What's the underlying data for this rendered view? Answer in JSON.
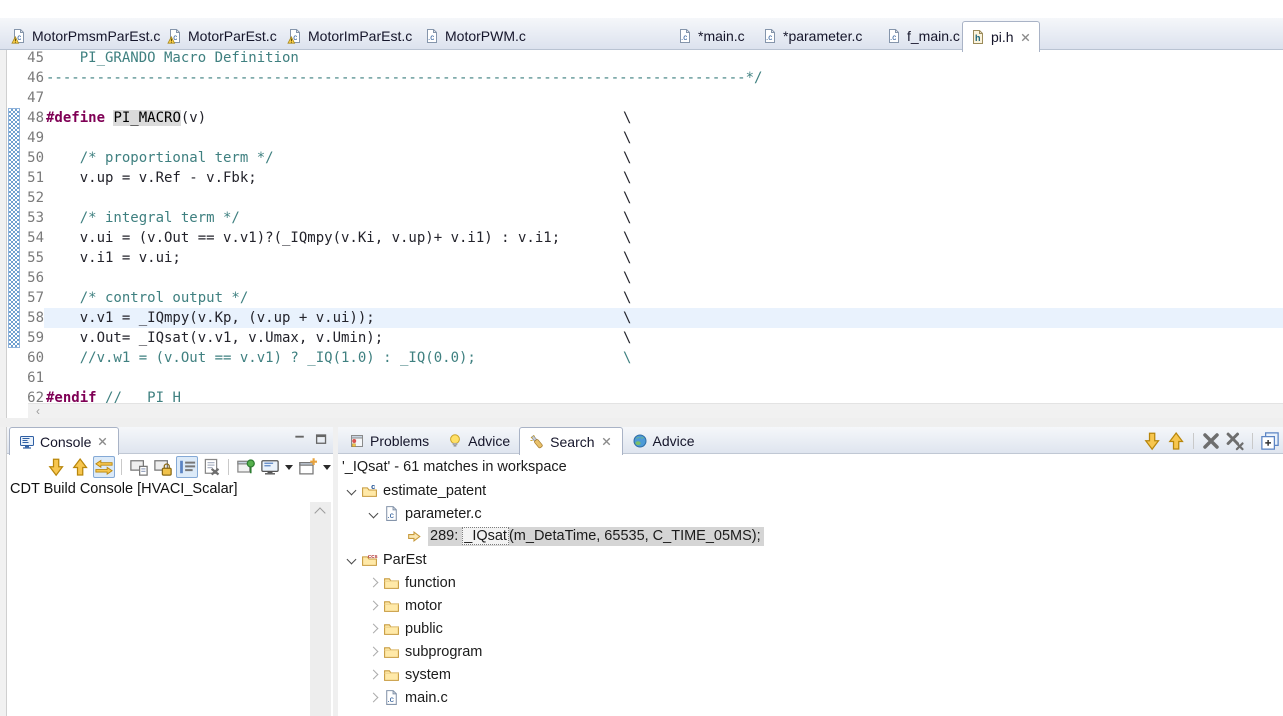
{
  "editor_tabs": [
    {
      "label": "MotorPmsmParEst.c",
      "icon": "c-file-warning-icon",
      "active": false
    },
    {
      "label": "MotorParEst.c",
      "icon": "c-file-warning-icon",
      "active": false
    },
    {
      "label": "MotorImParEst.c",
      "icon": "c-file-warning-icon",
      "active": false
    },
    {
      "label": "MotorPWM.c",
      "icon": "c-file-icon",
      "active": false
    },
    {
      "label": "*main.c",
      "icon": "c-file-icon",
      "active": false
    },
    {
      "label": "*parameter.c",
      "icon": "c-file-icon",
      "active": false
    },
    {
      "label": "f_main.c",
      "icon": "c-file-icon",
      "active": false
    },
    {
      "label": "pi.h",
      "icon": "h-file-icon",
      "active": true
    }
  ],
  "editor": {
    "continuation_char": "\\",
    "hscroll_left_char": "‹",
    "lines": [
      {
        "num": "45",
        "parts": [
          [
            "    PI_GRANDO Macro Definition",
            "com"
          ]
        ]
      },
      {
        "num": "46",
        "parts": [
          [
            "-----------------------------------------------------------------------------------*/",
            "com"
          ]
        ]
      },
      {
        "num": "47",
        "parts": []
      },
      {
        "num": "48",
        "parts": [
          [
            "#define ",
            "kw"
          ],
          [
            "PI_MACRO",
            "occ"
          ],
          [
            "(v)",
            "cd"
          ]
        ],
        "cont": "cd"
      },
      {
        "num": "49",
        "parts": [],
        "cont": "cd"
      },
      {
        "num": "50",
        "parts": [
          [
            "    /* proportional term */",
            "com"
          ]
        ],
        "cont": "cd"
      },
      {
        "num": "51",
        "parts": [
          [
            "    v.up = v.Ref - v.Fbk;",
            "cd"
          ]
        ],
        "cont": "cd"
      },
      {
        "num": "52",
        "parts": [],
        "cont": "cd"
      },
      {
        "num": "53",
        "parts": [
          [
            "    /* integral term */",
            "com"
          ]
        ],
        "cont": "cd"
      },
      {
        "num": "54",
        "parts": [
          [
            "    v.ui = (v.Out == v.v1)?(_IQmpy(v.Ki, v.up)+ v.i1) : v.i1;",
            "cd"
          ]
        ],
        "cont": "cd"
      },
      {
        "num": "55",
        "parts": [
          [
            "    v.i1 = v.ui;",
            "cd"
          ]
        ],
        "cont": "cd"
      },
      {
        "num": "56",
        "parts": [],
        "cont": "cd"
      },
      {
        "num": "57",
        "parts": [
          [
            "    /* control output */",
            "com"
          ]
        ],
        "cont": "cd"
      },
      {
        "num": "58",
        "parts": [
          [
            "    v.v1 = _IQmpy(v.Kp, (v.up + v.ui));",
            "cd"
          ]
        ],
        "cont": "cd",
        "cur": true
      },
      {
        "num": "59",
        "parts": [
          [
            "    v.Out= _IQsat(v.v1, v.Umax, v.Umin);",
            "cd"
          ]
        ],
        "cont": "cd"
      },
      {
        "num": "60",
        "parts": [
          [
            "    //v.w1 = (v.Out == v.v1) ? _IQ(1.0) : _IQ(0.0);",
            "com"
          ]
        ],
        "cont": "com"
      },
      {
        "num": "61",
        "parts": []
      },
      {
        "num": "62",
        "parts": [
          [
            "#endif ",
            "kw"
          ],
          [
            "//   PI H",
            "com"
          ]
        ]
      }
    ]
  },
  "console": {
    "tab_label": "Console",
    "title": "CDT Build Console [HVACI_Scalar]",
    "toolbar": [
      {
        "name": "down-arrow-icon"
      },
      {
        "name": "up-arrow-icon"
      },
      {
        "name": "swap-console-icon",
        "pressed": true
      },
      {
        "name": "sep"
      },
      {
        "name": "show-stdout-icon"
      },
      {
        "name": "show-stderr-icon"
      },
      {
        "name": "scroll-lock-icon",
        "pressed": true
      },
      {
        "name": "clear-console-icon"
      },
      {
        "name": "sep"
      },
      {
        "name": "pin-console-icon"
      },
      {
        "name": "display-console-icon"
      },
      {
        "name": "dropdown-icon"
      },
      {
        "name": "open-console-icon"
      },
      {
        "name": "dropdown-icon"
      }
    ]
  },
  "search": {
    "tabs": [
      {
        "label": "Problems",
        "icon": "problems-icon",
        "active": false
      },
      {
        "label": "Advice",
        "icon": "lightbulb-icon",
        "active": false
      },
      {
        "label": "Search",
        "icon": "search-icon",
        "active": true
      },
      {
        "label": "Advice",
        "icon": "globe-icon",
        "active": false
      }
    ],
    "summary": "'_IQsat' - 61 matches in workspace",
    "toolbar": [
      {
        "name": "next-match-icon"
      },
      {
        "name": "prev-match-icon"
      },
      {
        "name": "sep"
      },
      {
        "name": "remove-match-icon"
      },
      {
        "name": "remove-all-matches-icon"
      },
      {
        "name": "sep"
      },
      {
        "name": "expand-all-icon"
      }
    ],
    "tree": [
      {
        "level": 0,
        "state": "expanded",
        "icon": "c-project-icon",
        "label": "estimate_patent"
      },
      {
        "level": 1,
        "state": "expanded",
        "icon": "c-file-icon",
        "label": "parameter.c"
      },
      {
        "level": 2,
        "state": "match",
        "icon": "match-arrow-icon",
        "selected": true,
        "prefix": "289: ",
        "match": "_IQsat",
        "suffix": "(m_DetaTime, 65535, C_TIME_05MS);"
      },
      {
        "level": 0,
        "state": "expanded",
        "icon": "ccs-project-icon",
        "label": "ParEst"
      },
      {
        "level": 1,
        "state": "collapsed",
        "icon": "folder-icon",
        "label": "function"
      },
      {
        "level": 1,
        "state": "collapsed",
        "icon": "folder-icon",
        "label": "motor"
      },
      {
        "level": 1,
        "state": "collapsed",
        "icon": "folder-icon",
        "label": "public"
      },
      {
        "level": 1,
        "state": "collapsed",
        "icon": "folder-icon",
        "label": "subprogram"
      },
      {
        "level": 1,
        "state": "collapsed",
        "icon": "folder-icon",
        "label": "system"
      },
      {
        "level": 1,
        "state": "collapsed",
        "icon": "c-file-icon",
        "label": "main.c"
      }
    ]
  }
}
